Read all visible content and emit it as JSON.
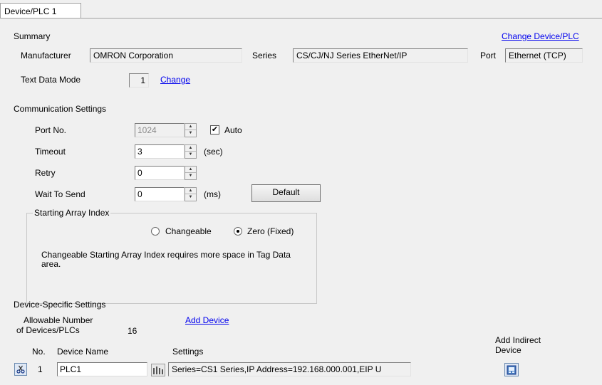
{
  "tab": {
    "label": "Device/PLC 1"
  },
  "summary": {
    "title": "Summary",
    "change_device_link": "Change Device/PLC",
    "manufacturer_label": "Manufacturer",
    "manufacturer_value": "OMRON Corporation",
    "series_label": "Series",
    "series_value": "CS/CJ/NJ Series EtherNet/IP",
    "port_label": "Port",
    "port_value": "Ethernet (TCP)",
    "text_mode_label": "Text Data Mode",
    "text_mode_value": "1",
    "change_link": "Change"
  },
  "comm": {
    "title": "Communication Settings",
    "port_label": "Port No.",
    "port_value": "1024",
    "auto_label": "Auto",
    "auto_checked": true,
    "timeout_label": "Timeout",
    "timeout_value": "3",
    "timeout_unit": "(sec)",
    "retry_label": "Retry",
    "retry_value": "0",
    "wait_label": "Wait To Send",
    "wait_value": "0",
    "wait_unit": "(ms)",
    "default_button": "Default",
    "array_group_title": "Starting Array Index",
    "changeable_label": "Changeable",
    "zero_label": "Zero (Fixed)",
    "selected_index": "Zero (Fixed)",
    "array_note": "Changeable Starting Array Index requires more space in Tag Data area."
  },
  "device": {
    "title": "Device-Specific Settings",
    "allowable_label_1": "Allowable Number",
    "allowable_label_2": "of Devices/PLCs",
    "allowable_value": "16",
    "add_device_link": "Add Device",
    "col_no": "No.",
    "col_name": "Device Name",
    "col_settings": "Settings",
    "col_indirect_1": "Add Indirect",
    "col_indirect_2": "Device",
    "rows": [
      {
        "no": "1",
        "name": "PLC1",
        "settings": "Series=CS1 Series,IP Address=192.168.000.001,EIP U"
      }
    ]
  },
  "icons": {
    "delete_row": "scissors-icon",
    "settings_button": "settings-grid-icon",
    "add_indirect": "add-indirect-device-icon"
  }
}
